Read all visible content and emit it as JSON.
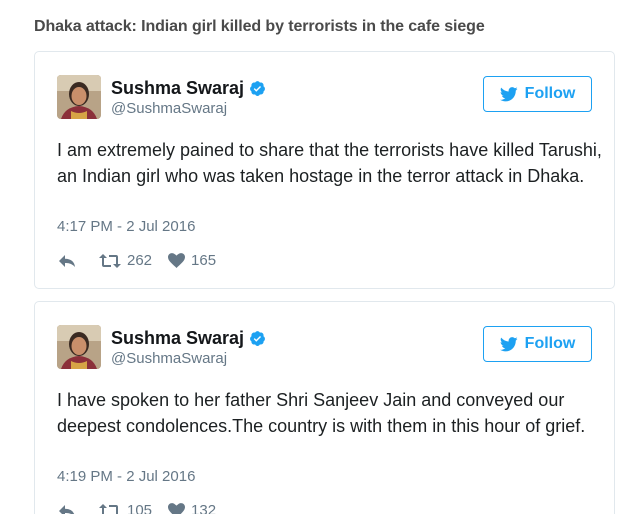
{
  "headline": "Dhaka attack: Indian girl killed by terrorists in the cafe siege",
  "colors": {
    "twitter_blue": "#1da1f2",
    "text": "#1c2022",
    "muted": "#657786",
    "border": "#e1e8ed",
    "headline": "#4a4a4a"
  },
  "tweets": [
    {
      "author_name": "Sushma Swaraj",
      "handle": "@SushmaSwaraj",
      "verified_icon": "verified-badge-icon",
      "follow_label": "Follow",
      "text": "I am extremely pained to share that the terrorists have killed Tarushi, an Indian girl who was taken hostage in the terror attack in Dhaka.",
      "timestamp": "4:17 PM - 2 Jul 2016",
      "retweets": "262",
      "likes": "165"
    },
    {
      "author_name": "Sushma Swaraj",
      "handle": "@SushmaSwaraj",
      "verified_icon": "verified-badge-icon",
      "follow_label": "Follow",
      "text": "I have spoken to her father Shri Sanjeev Jain and conveyed our deepest condolences.The country is with them in this hour of grief.",
      "timestamp": "4:19 PM - 2 Jul 2016",
      "retweets": "105",
      "likes": "132"
    }
  ]
}
